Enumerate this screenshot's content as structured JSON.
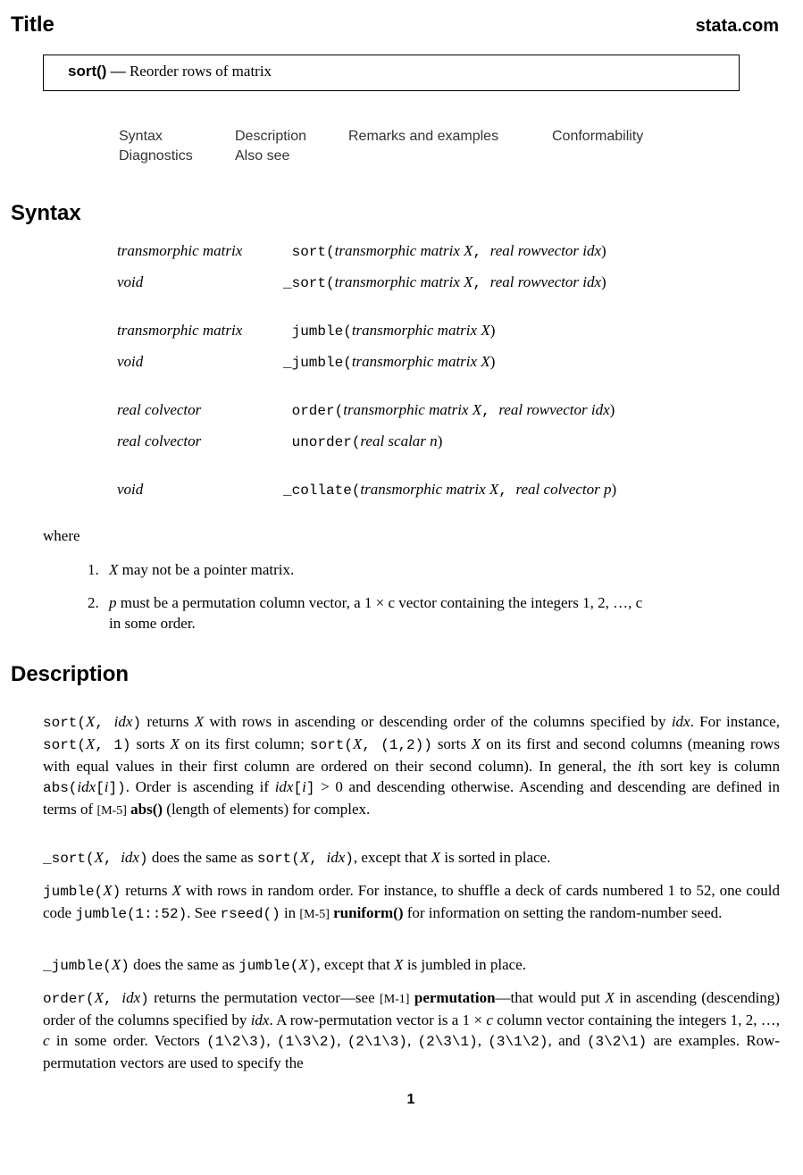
{
  "header": {
    "title": "Title",
    "site": "stata.com"
  },
  "title_box": {
    "function": "sort()",
    "dash": " — ",
    "description": "Reorder rows of matrix"
  },
  "nav": {
    "links": [
      "Syntax",
      "Description",
      "Remarks and examples",
      "Conformability",
      "Diagnostics",
      "Also see"
    ]
  },
  "syntax": {
    "heading": "Syntax",
    "entries": [
      {
        "ret": "transmorphic matrix",
        "fn": " sort(",
        "args": "transmorphic matrix X",
        "sep": ", ",
        "args2": "real rowvector idx",
        "close": ")"
      },
      {
        "ret": "void",
        "fn": "_sort(",
        "args": "transmorphic matrix X",
        "sep": ", ",
        "args2": "real rowvector idx",
        "close": ")"
      },
      {
        "ret": "transmorphic matrix",
        "fn": " jumble(",
        "args": "transmorphic matrix X",
        "sep": "",
        "args2": "",
        "close": ")"
      },
      {
        "ret": "void",
        "fn": "_jumble(",
        "args": "transmorphic matrix X",
        "sep": "",
        "args2": "",
        "close": ")"
      },
      {
        "ret": "real colvector",
        "fn": " order(",
        "args": "transmorphic matrix X",
        "sep": ", ",
        "args2": "real rowvector idx",
        "close": ")"
      },
      {
        "ret": "real colvector",
        "fn": " unorder(",
        "args": "real scalar n",
        "sep": "",
        "args2": "",
        "close": ")"
      },
      {
        "ret": "void",
        "fn": "_collate(",
        "args": "transmorphic matrix X",
        "sep": ", ",
        "args2": "real colvector p",
        "close": ")"
      }
    ],
    "where_label": "where",
    "where_items": [
      {
        "num": "1.",
        "var": "X",
        "text": " may not be a pointer matrix."
      },
      {
        "num": "2.",
        "var": "p",
        "text": " must be a permutation column vector, a 1 × c vector containing the integers 1, 2, …, c",
        "cont": "in some order."
      }
    ]
  },
  "description": {
    "heading": "Description",
    "p1": {
      "a": "sort(",
      "b": "X",
      "c": ", ",
      "d": "idx",
      "e": ")",
      "f": " returns ",
      "g": "X",
      "h": " with rows in ascending or descending order of the columns specified by ",
      "i": "idx",
      "j": ". For instance, ",
      "k": "sort(",
      "l": "X",
      "m": ", 1)",
      "n": " sorts ",
      "o": "X",
      "p": " on its first column; ",
      "q": "sort(",
      "r": "X",
      "s": ", (1,2))",
      "t": " sorts ",
      "u": "X",
      "v": " on its first and second columns (meaning rows with equal values in their first column are ordered on their second column). In general, the ",
      "w": "i",
      "x": "th sort key is column ",
      "y": "abs(",
      "z": "idx",
      "aa": "[",
      "ab": "i",
      "ac": "])",
      "ad": ". Order is ascending if ",
      "ae": "idx",
      "af": "[",
      "ag": "i",
      "ah": "]",
      "ai": " > 0 and descending otherwise. Ascending and descending are defined in terms of ",
      "aj": "[M-5]",
      "ak": " abs()",
      "al": " (length of elements) for complex."
    },
    "p2": {
      "a": "_sort(",
      "b": "X",
      "c": ", ",
      "d": "idx",
      "e": ")",
      "f": " does the same as ",
      "g": "sort(",
      "h": "X",
      "i": ", ",
      "j": "idx",
      "k": ")",
      "l": ", except that ",
      "m": "X",
      "n": " is sorted in place."
    },
    "p3": {
      "a": "jumble(",
      "b": "X",
      "c": ")",
      "d": " returns ",
      "e": "X",
      "f": " with rows in random order. For instance, to shuffle a deck of cards numbered 1 to 52, one could code ",
      "g": "jumble(1::52)",
      "h": ". See ",
      "i": "rseed()",
      "j": " in ",
      "k": "[M-5]",
      "l": " runiform()",
      "m": " for information on setting the random-number seed."
    },
    "p4": {
      "a": "_jumble(",
      "b": "X",
      "c": ")",
      "d": " does the same as ",
      "e": "jumble(",
      "f": "X",
      "g": ")",
      "h": ", except that ",
      "i": "X",
      "j": " is jumbled in place."
    },
    "p5": {
      "a": "order(",
      "b": "X",
      "c": ", ",
      "d": "idx",
      "e": ")",
      "f": " returns the permutation vector—see ",
      "g": "[M-1]",
      "h": " permutation",
      "i": "—that would put ",
      "j": "X",
      "k": " in ascending (descending) order of the columns specified by ",
      "l": "idx",
      "m": ". A row-permutation vector is a 1 × ",
      "n": "c",
      "o": " column vector containing the integers 1, 2, …, ",
      "p": "c",
      "q": " in some order. Vectors ",
      "r": "(1\\2\\3)",
      "s": ", ",
      "t": "(1\\3\\2)",
      "u": ", ",
      "v": "(2\\1\\3)",
      "w": ", ",
      "x": "(2\\3\\1)",
      "y": ", ",
      "z": "(3\\1\\2)",
      "aa": ", and ",
      "ab": "(3\\2\\1)",
      "ac": " are examples. Row-permutation vectors are used to specify the"
    }
  },
  "footer": {
    "page_number": "1"
  }
}
